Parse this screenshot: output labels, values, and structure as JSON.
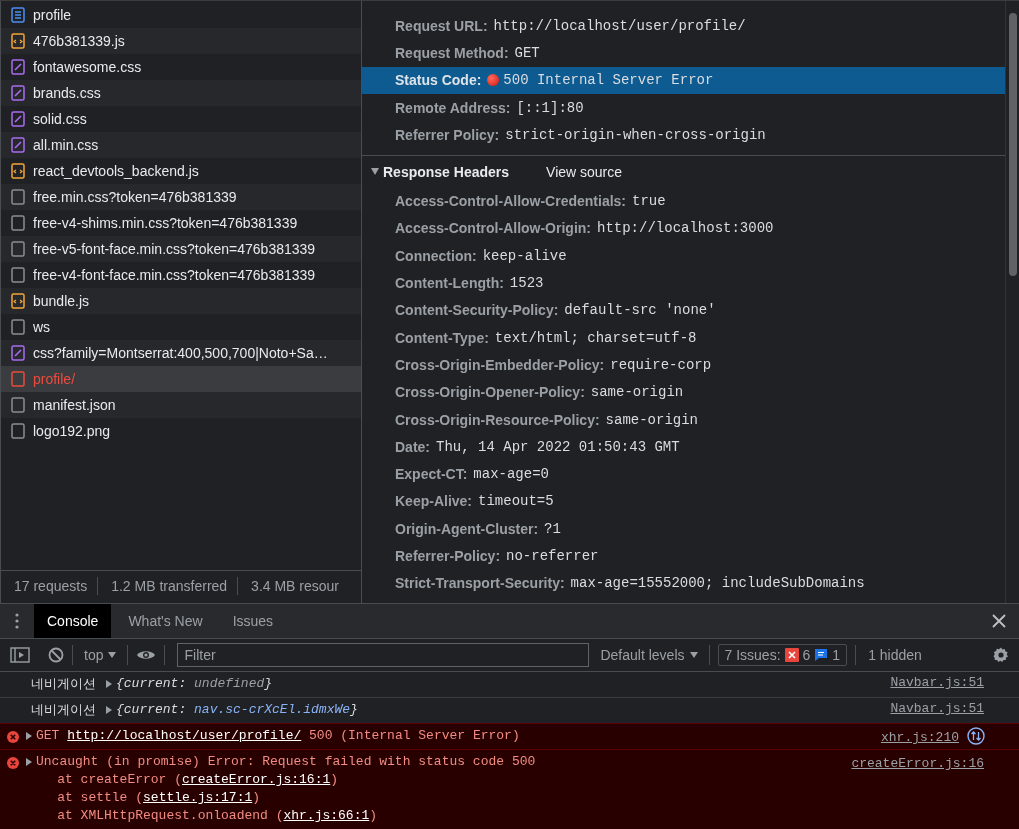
{
  "requests": [
    {
      "name": "profile",
      "kind": "doc",
      "failed": false,
      "selected": false
    },
    {
      "name": "476b381339.js",
      "kind": "js",
      "failed": false,
      "selected": false
    },
    {
      "name": "fontawesome.css",
      "kind": "css",
      "failed": false,
      "selected": false
    },
    {
      "name": "brands.css",
      "kind": "css",
      "failed": false,
      "selected": false
    },
    {
      "name": "solid.css",
      "kind": "css",
      "failed": false,
      "selected": false
    },
    {
      "name": "all.min.css",
      "kind": "css",
      "failed": false,
      "selected": false
    },
    {
      "name": "react_devtools_backend.js",
      "kind": "js",
      "failed": false,
      "selected": false
    },
    {
      "name": "free.min.css?token=476b381339",
      "kind": "other",
      "failed": false,
      "selected": false
    },
    {
      "name": "free-v4-shims.min.css?token=476b381339",
      "kind": "other",
      "failed": false,
      "selected": false
    },
    {
      "name": "free-v5-font-face.min.css?token=476b381339",
      "kind": "other",
      "failed": false,
      "selected": false
    },
    {
      "name": "free-v4-font-face.min.css?token=476b381339",
      "kind": "other",
      "failed": false,
      "selected": false
    },
    {
      "name": "bundle.js",
      "kind": "js",
      "failed": false,
      "selected": false
    },
    {
      "name": "ws",
      "kind": "other",
      "failed": false,
      "selected": false
    },
    {
      "name": "css?family=Montserrat:400,500,700|Noto+Sa…",
      "kind": "css",
      "failed": false,
      "selected": false
    },
    {
      "name": "profile/",
      "kind": "other",
      "failed": true,
      "selected": true
    },
    {
      "name": "manifest.json",
      "kind": "other",
      "failed": false,
      "selected": false
    },
    {
      "name": "logo192.png",
      "kind": "other",
      "failed": false,
      "selected": false
    }
  ],
  "summary": [
    "17 requests",
    "1.2 MB transferred",
    "3.4 MB resour"
  ],
  "general": [
    {
      "name": "Request URL:",
      "value": "http://localhost/user/profile/",
      "kind": "plain",
      "highlighted": false
    },
    {
      "name": "Request Method:",
      "value": "GET",
      "kind": "plain",
      "highlighted": false
    },
    {
      "name": "Status Code:",
      "value": "500 Internal Server Error",
      "kind": "status",
      "highlighted": true
    },
    {
      "name": "Remote Address:",
      "value": "[::1]:80",
      "kind": "plain",
      "highlighted": false
    },
    {
      "name": "Referrer Policy:",
      "value": "strict-origin-when-cross-origin",
      "kind": "plain",
      "highlighted": false
    }
  ],
  "response_headers": {
    "title": "Response Headers",
    "expanded": true,
    "view_source": "View source",
    "items": [
      {
        "name": "Access-Control-Allow-Credentials:",
        "value": "true"
      },
      {
        "name": "Access-Control-Allow-Origin:",
        "value": "http://localhost:3000"
      },
      {
        "name": "Connection:",
        "value": "keep-alive"
      },
      {
        "name": "Content-Length:",
        "value": "1523"
      },
      {
        "name": "Content-Security-Policy:",
        "value": "default-src 'none'"
      },
      {
        "name": "Content-Type:",
        "value": "text/html; charset=utf-8"
      },
      {
        "name": "Cross-Origin-Embedder-Policy:",
        "value": "require-corp"
      },
      {
        "name": "Cross-Origin-Opener-Policy:",
        "value": "same-origin"
      },
      {
        "name": "Cross-Origin-Resource-Policy:",
        "value": "same-origin"
      },
      {
        "name": "Date:",
        "value": "Thu, 14 Apr 2022 01:50:43 GMT"
      },
      {
        "name": "Expect-CT:",
        "value": "max-age=0"
      },
      {
        "name": "Keep-Alive:",
        "value": "timeout=5"
      },
      {
        "name": "Origin-Agent-Cluster:",
        "value": "?1"
      },
      {
        "name": "Referrer-Policy:",
        "value": "no-referrer"
      },
      {
        "name": "Strict-Transport-Security:",
        "value": "max-age=15552000; includeSubDomains"
      }
    ]
  },
  "drawer": {
    "tabs": [
      {
        "label": "Console",
        "selected": true
      },
      {
        "label": "What's New",
        "selected": false
      },
      {
        "label": "Issues",
        "selected": false
      }
    ]
  },
  "console_toolbar": {
    "context": "top",
    "filter_placeholder": "Filter",
    "levels": "Default levels",
    "issues_label": "7 Issues:",
    "issues_errors": "6",
    "issues_info": "1",
    "hidden": "1 hidden"
  },
  "messages": [
    {
      "kind": "log",
      "expandable": true,
      "source": "Navbar.js:51",
      "network": false,
      "lines": [
        [
          {
            "text": "네비게이션",
            "kind": "label"
          },
          {
            "text": "{",
            "kind": "punct"
          },
          {
            "text": "current",
            "kind": "key"
          },
          {
            "text": ": ",
            "kind": "punct"
          },
          {
            "text": "undefined",
            "kind": "undefined"
          },
          {
            "text": "}",
            "kind": "punct"
          }
        ]
      ]
    },
    {
      "kind": "log",
      "expandable": true,
      "source": "Navbar.js:51",
      "network": false,
      "lines": [
        [
          {
            "text": "네비게이션",
            "kind": "label"
          },
          {
            "text": "{",
            "kind": "punct"
          },
          {
            "text": "current",
            "kind": "key"
          },
          {
            "text": ": ",
            "kind": "punct"
          },
          {
            "text": "nav.sc-crXcEl.idmxWe",
            "kind": "node"
          },
          {
            "text": "}",
            "kind": "punct"
          }
        ]
      ]
    },
    {
      "kind": "error",
      "expandable": true,
      "source": "xhr.js:210",
      "network": true,
      "lines": [
        [
          {
            "text": "GET ",
            "kind": "plain"
          },
          {
            "text": "http://localhost/user/profile/",
            "kind": "link"
          },
          {
            "text": " 500 (Internal Server Error)",
            "kind": "plain"
          }
        ]
      ]
    },
    {
      "kind": "error",
      "expandable": true,
      "source": "createError.js:16",
      "network": false,
      "lines": [
        [
          {
            "text": "Uncaught (in promise) Error: Request failed with status code 500",
            "kind": "plain"
          }
        ],
        [
          {
            "text": "    at createError (",
            "kind": "plain"
          },
          {
            "text": "createError.js:16:1",
            "kind": "link"
          },
          {
            "text": ")",
            "kind": "plain"
          }
        ],
        [
          {
            "text": "    at settle (",
            "kind": "plain"
          },
          {
            "text": "settle.js:17:1",
            "kind": "link"
          },
          {
            "text": ")",
            "kind": "plain"
          }
        ],
        [
          {
            "text": "    at XMLHttpRequest.onloadend (",
            "kind": "plain"
          },
          {
            "text": "xhr.js:66:1",
            "kind": "link"
          },
          {
            "text": ")",
            "kind": "plain"
          }
        ]
      ]
    }
  ]
}
